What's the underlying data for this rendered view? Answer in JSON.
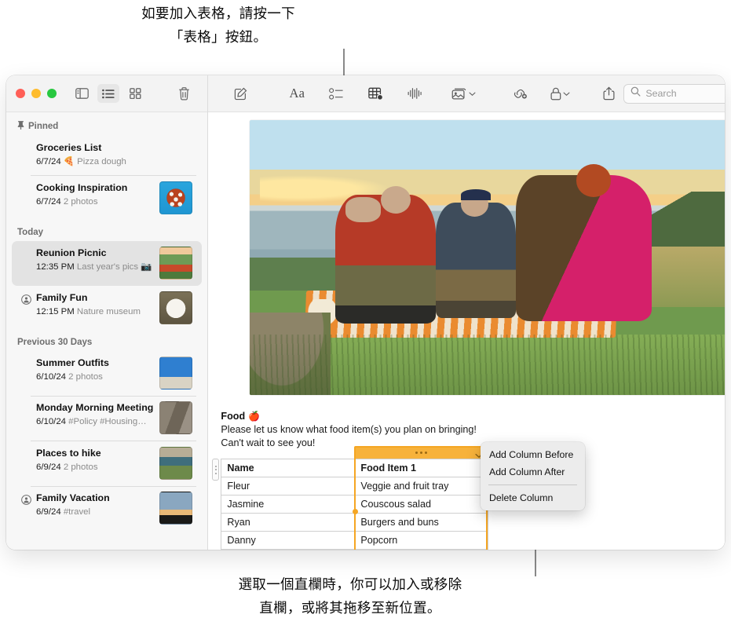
{
  "annotations": {
    "top": "如要加入表格，請按一下\n「表格」按鈕。",
    "bottom": "選取一個直欄時，你可以加入或移除\n直欄，或將其拖移至新位置。"
  },
  "window": {
    "traffic_lights": [
      "close",
      "minimize",
      "maximize"
    ],
    "sidebar_toolbar": {
      "sidebar_toggle": "sidebar-toggle",
      "list_view": "list-view",
      "gallery_view": "gallery-view",
      "delete": "delete-note"
    }
  },
  "sidebar": {
    "groups": [
      {
        "label": "Pinned",
        "icon": "pin-icon",
        "notes": [
          {
            "title": "Groceries List",
            "date": "6/7/24",
            "preview": "🍕 Pizza dough",
            "thumb": "none",
            "shared": false
          },
          {
            "title": "Cooking Inspiration",
            "date": "6/7/24",
            "preview": "2 photos",
            "thumb": "th-pizza",
            "shared": false
          }
        ]
      },
      {
        "label": "Today",
        "icon": "",
        "notes": [
          {
            "title": "Reunion Picnic",
            "date": "12:35 PM",
            "preview": "Last year's pics 📷",
            "thumb": "th-picnic",
            "shared": false,
            "selected": true
          },
          {
            "title": "Family Fun",
            "date": "12:15 PM",
            "preview": "Nature museum",
            "thumb": "th-plate",
            "shared": true
          }
        ]
      },
      {
        "label": "Previous 30 Days",
        "icon": "",
        "notes": [
          {
            "title": "Summer Outfits",
            "date": "6/10/24",
            "preview": "2 photos",
            "thumb": "th-outfit",
            "shared": false
          },
          {
            "title": "Monday Morning Meeting",
            "date": "6/10/24",
            "preview": "#Policy #Housing…",
            "thumb": "th-climb",
            "shared": false
          },
          {
            "title": "Places to hike",
            "date": "6/9/24",
            "preview": "2 photos",
            "thumb": "th-hike",
            "shared": false
          },
          {
            "title": "Family Vacation",
            "date": "6/9/24",
            "preview": "#travel",
            "thumb": "th-vacation",
            "shared": true
          }
        ]
      }
    ]
  },
  "detail_toolbar": {
    "compose": "compose-icon",
    "format": "Aa",
    "checklist": "checklist-icon",
    "table": "table-icon",
    "audio": "audio-waveform-icon",
    "media": "media-icon",
    "link": "link-icon",
    "lock": "lock-icon",
    "share": "share-icon"
  },
  "search": {
    "placeholder": "Search",
    "value": ""
  },
  "note": {
    "heading": "Food",
    "heading_emoji": "🍎",
    "paragraph_line1": "Please let us know what food item(s) you plan on bringing!",
    "paragraph_line2": "Can't wait to see you!",
    "photo_alt": "Three friends sitting on an orange picnic blanket on a grassy cliff at sunset"
  },
  "table": {
    "headers": [
      "Name",
      "Food Item 1"
    ],
    "rows": [
      [
        "Fleur",
        "Veggie and fruit tray"
      ],
      [
        "Jasmine",
        "Couscous salad"
      ],
      [
        "Ryan",
        "Burgers and buns"
      ],
      [
        "Danny",
        "Popcorn"
      ]
    ],
    "selected_column_index": 1,
    "selection_color": "#f7b23b"
  },
  "context_menu": {
    "items": [
      {
        "label": "Add Column Before"
      },
      {
        "label": "Add Column After"
      },
      {
        "label": "Delete Column"
      }
    ]
  }
}
